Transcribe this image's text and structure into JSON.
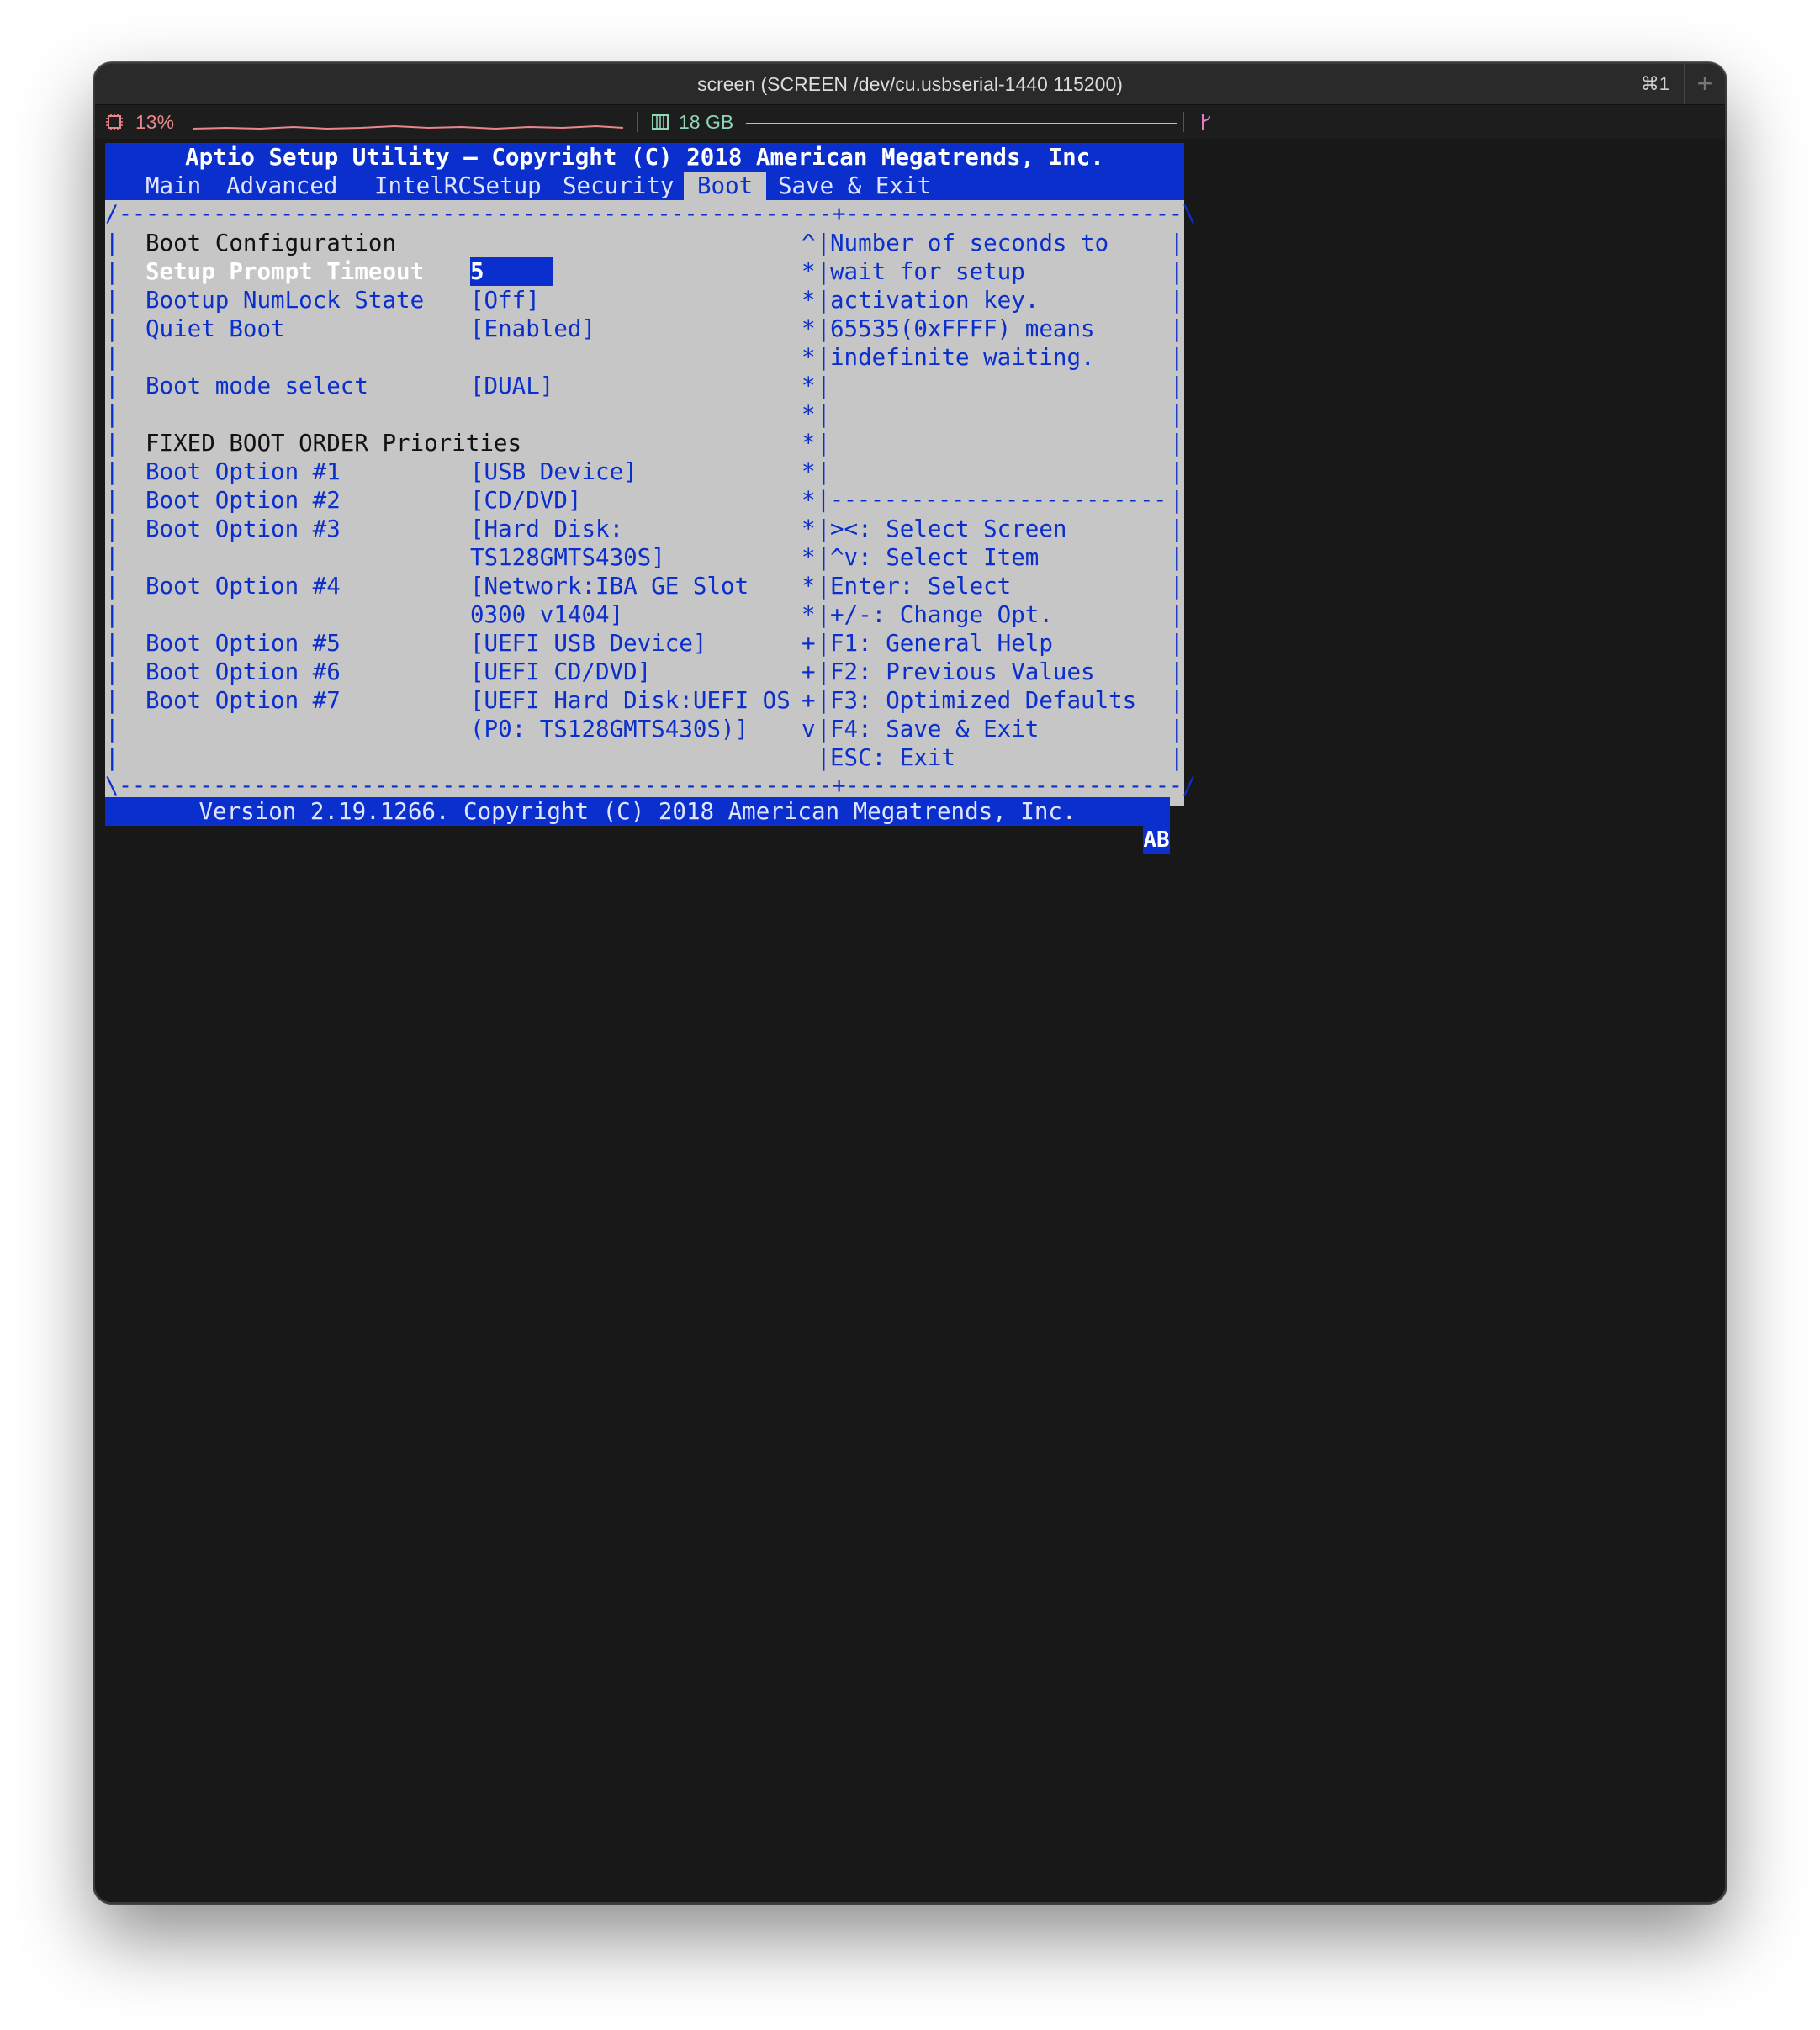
{
  "window": {
    "title": "screen (SCREEN /dev/cu.usbserial-1440 115200)",
    "shortcut": "⌘1",
    "new_tab": "+"
  },
  "statusbar": {
    "cpu": "13%",
    "memory": "18 GB"
  },
  "bios": {
    "title": "Aptio Setup Utility – Copyright (C) 2018 American Megatrends, Inc.",
    "tabs": [
      {
        "label": "Main",
        "active": false
      },
      {
        "label": "Advanced",
        "active": false
      },
      {
        "label": "IntelRCSetup",
        "active": false
      },
      {
        "label": "Security",
        "active": false
      },
      {
        "label": "Boot",
        "active": true
      },
      {
        "label": "Save & Exit",
        "active": false
      }
    ],
    "frame": {
      "top": "/-----------------------------------------------------+-------------------------\\",
      "bottom": "\\-----------------------------------------------------+-------------------------/",
      "separator": "|-------------------------",
      "bar": "|"
    },
    "items": {
      "boot_configuration": "Boot Configuration",
      "setup_prompt_timeout": {
        "label": "Setup Prompt Timeout",
        "value": "5     "
      },
      "bootup_numlock": {
        "label": "Bootup NumLock State",
        "value": "[Off]"
      },
      "quiet_boot": {
        "label": "Quiet Boot",
        "value": "[Enabled]"
      },
      "boot_mode": {
        "label": "Boot mode select",
        "value": "[DUAL]"
      },
      "fixed_boot_order": "FIXED BOOT ORDER Priorities",
      "boot_option_1": {
        "label": "Boot Option #1",
        "value": "[USB Device]"
      },
      "boot_option_2": {
        "label": "Boot Option #2",
        "value": "[CD/DVD]"
      },
      "boot_option_3": {
        "label": "Boot Option #3",
        "value_line1": "[Hard Disk:",
        "value_line2": "TS128GMTS430S]"
      },
      "boot_option_4": {
        "label": "Boot Option #4",
        "value_line1": "[Network:IBA GE Slot",
        "value_line2": "0300 v1404]"
      },
      "boot_option_5": {
        "label": "Boot Option #5",
        "value": "[UEFI USB Device]"
      },
      "boot_option_6": {
        "label": "Boot Option #6",
        "value": "[UEFI CD/DVD]"
      },
      "boot_option_7": {
        "label": "Boot Option #7",
        "value_line1": "[UEFI Hard Disk:UEFI OS",
        "value_line2": "(P0: TS128GMTS430S)]"
      }
    },
    "scroll_markers": [
      "^",
      "*",
      "*",
      "*",
      "*",
      "*",
      "*",
      "*",
      "*",
      "*",
      "*",
      "*",
      "*",
      "*",
      "+",
      "+",
      "+",
      "v",
      " "
    ],
    "help": {
      "description": [
        "Number of seconds to",
        "wait for setup",
        "activation key.",
        "65535(0xFFFF) means",
        "indefinite waiting."
      ],
      "keys": [
        "><: Select Screen",
        "^v: Select Item",
        "Enter: Select",
        "+/-: Change Opt.",
        "F1: General Help",
        "F2: Previous Values",
        "F3: Optimized Defaults",
        "F4: Save & Exit",
        "ESC: Exit"
      ]
    },
    "footer": "Version 2.19.1266. Copyright (C) 2018 American Megatrends, Inc.",
    "badge": "AB"
  },
  "colors": {
    "bios_blue": "#0a2fcc",
    "bios_gray": "#c6c6c6",
    "terminal_bg": "#181818",
    "cpu_color": "#e8878a",
    "mem_color": "#8ed9b4"
  }
}
